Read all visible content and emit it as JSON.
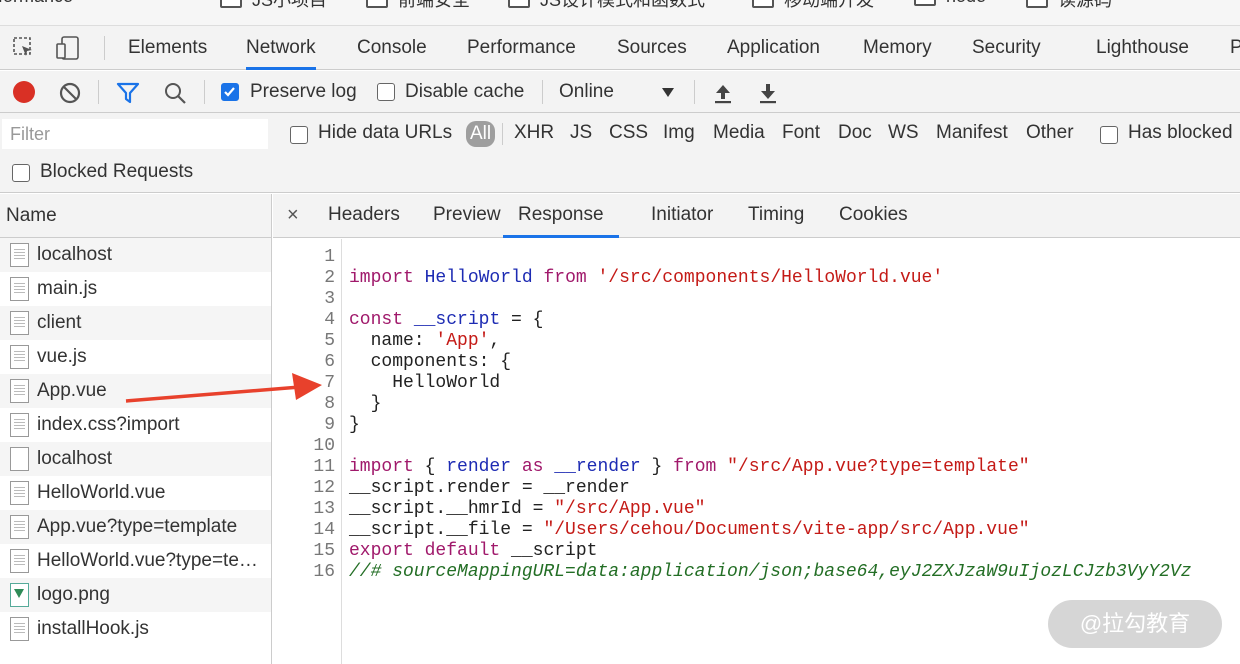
{
  "bookmarks": [
    {
      "label": "performance"
    },
    {
      "label": "JS小项目"
    },
    {
      "label": "前端安全"
    },
    {
      "label": "JS设计模式和函数式"
    },
    {
      "label": "移动端开发"
    },
    {
      "label": "node"
    },
    {
      "label": "读源码"
    }
  ],
  "devtools_tabs": [
    "Elements",
    "Network",
    "Console",
    "Performance",
    "Sources",
    "Application",
    "Memory",
    "Security",
    "Lighthouse",
    "P"
  ],
  "active_tab": "Network",
  "toolbar": {
    "preserve_log": "Preserve log",
    "preserve_log_checked": true,
    "disable_cache": "Disable cache",
    "disable_cache_checked": false,
    "throttle": "Online"
  },
  "filter": {
    "placeholder": "Filter",
    "hide_data_urls": "Hide data URLs",
    "types": [
      "All",
      "XHR",
      "JS",
      "CSS",
      "Img",
      "Media",
      "Font",
      "Doc",
      "WS",
      "Manifest",
      "Other"
    ],
    "has_blocked": "Has blocked",
    "blocked_requests": "Blocked Requests"
  },
  "name_column": {
    "header": "Name",
    "rows": [
      {
        "name": "localhost",
        "icon": "document-icon"
      },
      {
        "name": "main.js",
        "icon": "document-icon"
      },
      {
        "name": "client",
        "icon": "document-icon"
      },
      {
        "name": "vue.js",
        "icon": "document-icon"
      },
      {
        "name": "App.vue",
        "icon": "document-icon"
      },
      {
        "name": "index.css?import",
        "icon": "document-icon"
      },
      {
        "name": "localhost",
        "icon": "blank-document-icon"
      },
      {
        "name": "HelloWorld.vue",
        "icon": "document-icon"
      },
      {
        "name": "App.vue?type=template",
        "icon": "document-icon"
      },
      {
        "name": "HelloWorld.vue?type=te…",
        "icon": "document-icon"
      },
      {
        "name": "logo.png",
        "icon": "image-icon"
      },
      {
        "name": "installHook.js",
        "icon": "document-icon"
      }
    ]
  },
  "detail_tabs": [
    "Headers",
    "Preview",
    "Response",
    "Initiator",
    "Timing",
    "Cookies"
  ],
  "active_detail_tab": "Response",
  "code_lines": [
    {
      "n": "1",
      "html": ""
    },
    {
      "n": "2",
      "html": "<span class=\"kw\">import</span> <span class=\"id\">HelloWorld</span> <span class=\"kw\">from</span> <span class=\"str\">'/src/components/HelloWorld.vue'</span>"
    },
    {
      "n": "3",
      "html": ""
    },
    {
      "n": "4",
      "html": "<span class=\"kw\">const</span> <span class=\"id\">__script</span> = {"
    },
    {
      "n": "5",
      "html": "  name: <span class=\"str\">'App'</span>,"
    },
    {
      "n": "6",
      "html": "  components: {"
    },
    {
      "n": "7",
      "html": "    HelloWorld"
    },
    {
      "n": "8",
      "html": "  }"
    },
    {
      "n": "9",
      "html": "}"
    },
    {
      "n": "10",
      "html": ""
    },
    {
      "n": "11",
      "html": "<span class=\"kw\">import</span> { <span class=\"id\">render</span> <span class=\"kw\">as</span> <span class=\"id\">__render</span> } <span class=\"kw\">from</span> <span class=\"str\">\"/src/App.vue?type=template\"</span>"
    },
    {
      "n": "12",
      "html": "__script.render = __render"
    },
    {
      "n": "13",
      "html": "__script.__hmrId = <span class=\"str\">\"/src/App.vue\"</span>"
    },
    {
      "n": "14",
      "html": "__script.__file = <span class=\"str\">\"/Users/cehou/Documents/vite-app/src/App.vue\"</span>"
    },
    {
      "n": "15",
      "html": "<span class=\"kw\">export</span> <span class=\"kw\">default</span> __script"
    },
    {
      "n": "16",
      "html": "<span class=\"cmt\">//# sourceMappingURL=data:application/json;base64,eyJ2ZXJzaW9uIjozLCJzb3VyY2Vz</span>"
    }
  ],
  "watermark": "@拉勾教育",
  "colors": {
    "accent": "#1a73e8",
    "record": "#d93025",
    "arrow": "#e8412c"
  }
}
